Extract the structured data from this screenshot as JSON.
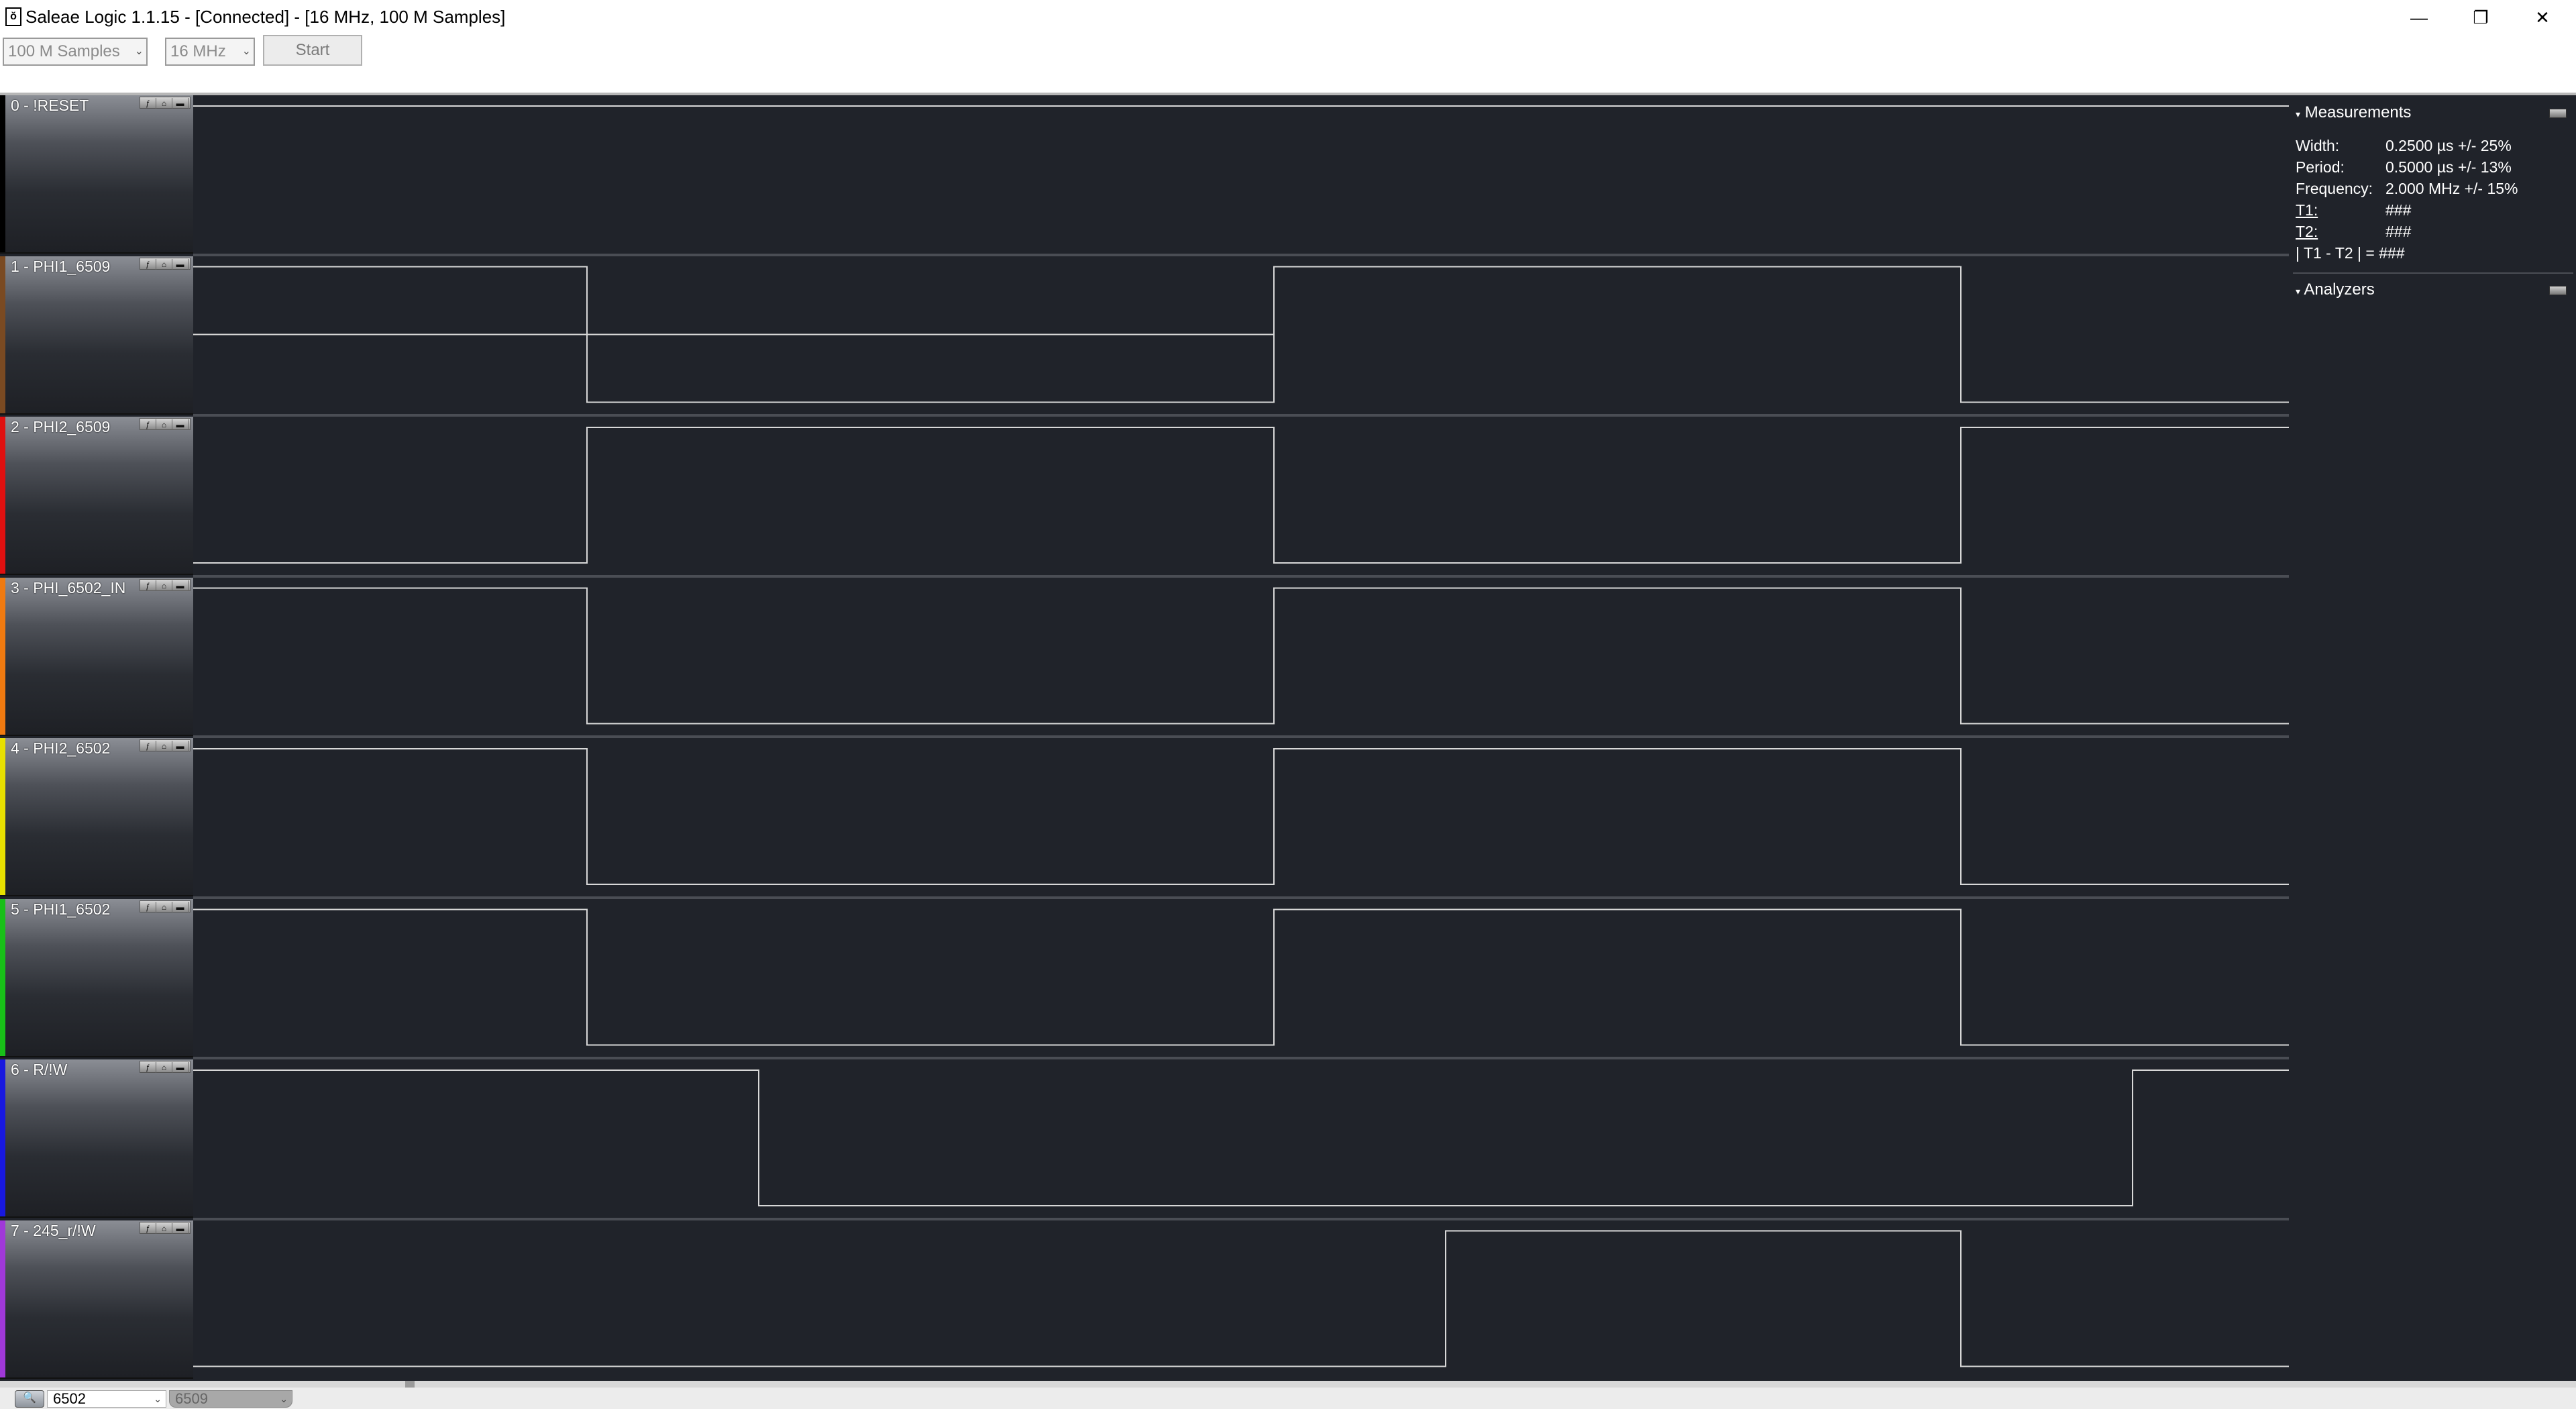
{
  "window": {
    "title": "Saleae Logic 1.1.15 - [Connected] - [16 MHz, 100 M Samples]",
    "icon_text": "ŏ",
    "minimize_glyph": "—",
    "maximize_glyph": "❐",
    "close_glyph": "✕"
  },
  "toolbar": {
    "samples_value": "100 M Samples",
    "rate_value": "16 MHz",
    "start_label": "Start"
  },
  "channels": [
    {
      "name": "0 - !RESET",
      "color": "#000000"
    },
    {
      "name": "1 - PHI1_6509",
      "color": "#7a4a22"
    },
    {
      "name": "2 - PHI2_6509",
      "color": "#e01010"
    },
    {
      "name": "3 - PHI_6502_IN",
      "color": "#f07a10"
    },
    {
      "name": "4 - PHI2_6502",
      "color": "#e8e000"
    },
    {
      "name": "5 - PHI1_6502",
      "color": "#18c018"
    },
    {
      "name": "6 - R/!W",
      "color": "#1818e0"
    },
    {
      "name": "7 - 245_r/!W",
      "color": "#a038d8"
    }
  ],
  "channel_button_glyphs": [
    "ƒ",
    "⌂",
    "▬"
  ],
  "measurements": {
    "header": "Measurements",
    "rows": [
      {
        "key": "Width:",
        "value": "0.2500 µs +/- 25%"
      },
      {
        "key": "Period:",
        "value": "0.5000 µs +/- 13%"
      },
      {
        "key": "Frequency:",
        "value": "2.000 MHz +/- 15%"
      },
      {
        "key": "T1:",
        "value": "###"
      },
      {
        "key": "T2:",
        "value": "###"
      }
    ],
    "diff_row": "| T1 - T2 | = ###"
  },
  "analyzers": {
    "header": "Analyzers"
  },
  "bottom": {
    "tab1": "6502",
    "tab2": "6509",
    "zoom_glyph": "🔍"
  },
  "colors": {
    "background": "#20232a",
    "trace": "#d8d8d8"
  }
}
